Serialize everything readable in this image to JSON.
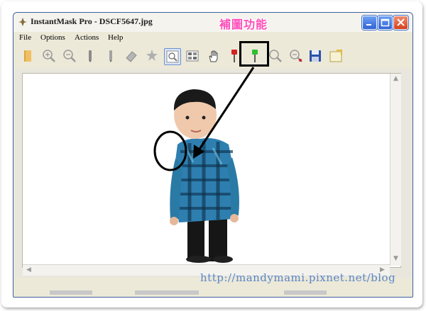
{
  "window": {
    "title": "InstantMask Pro - DSCF5647.jpg",
    "overlay_label": "補圖功能"
  },
  "menu": [
    "File",
    "Options",
    "Actions",
    "Help"
  ],
  "toolbar": {
    "tools": [
      "open-book-icon",
      "zoom-in-icon",
      "zoom-out-icon",
      "pencil-icon",
      "pencil-gray-icon",
      "eraser-icon",
      "magic-wand-icon",
      "zoom-fit-icon",
      "grid-icon",
      "hand-icon",
      "red-brush-icon",
      "green-brush-icon",
      "zoom-plus-icon",
      "zoom-minus-icon",
      "save-icon",
      "export-icon"
    ],
    "active_tool": "green-brush-icon"
  },
  "colors": {
    "overlay_label": "#ff4db8",
    "watermark": "#5b86c8",
    "highlight_box": "#000000"
  },
  "watermark": "http://mandymami.pixnet.net/blog"
}
